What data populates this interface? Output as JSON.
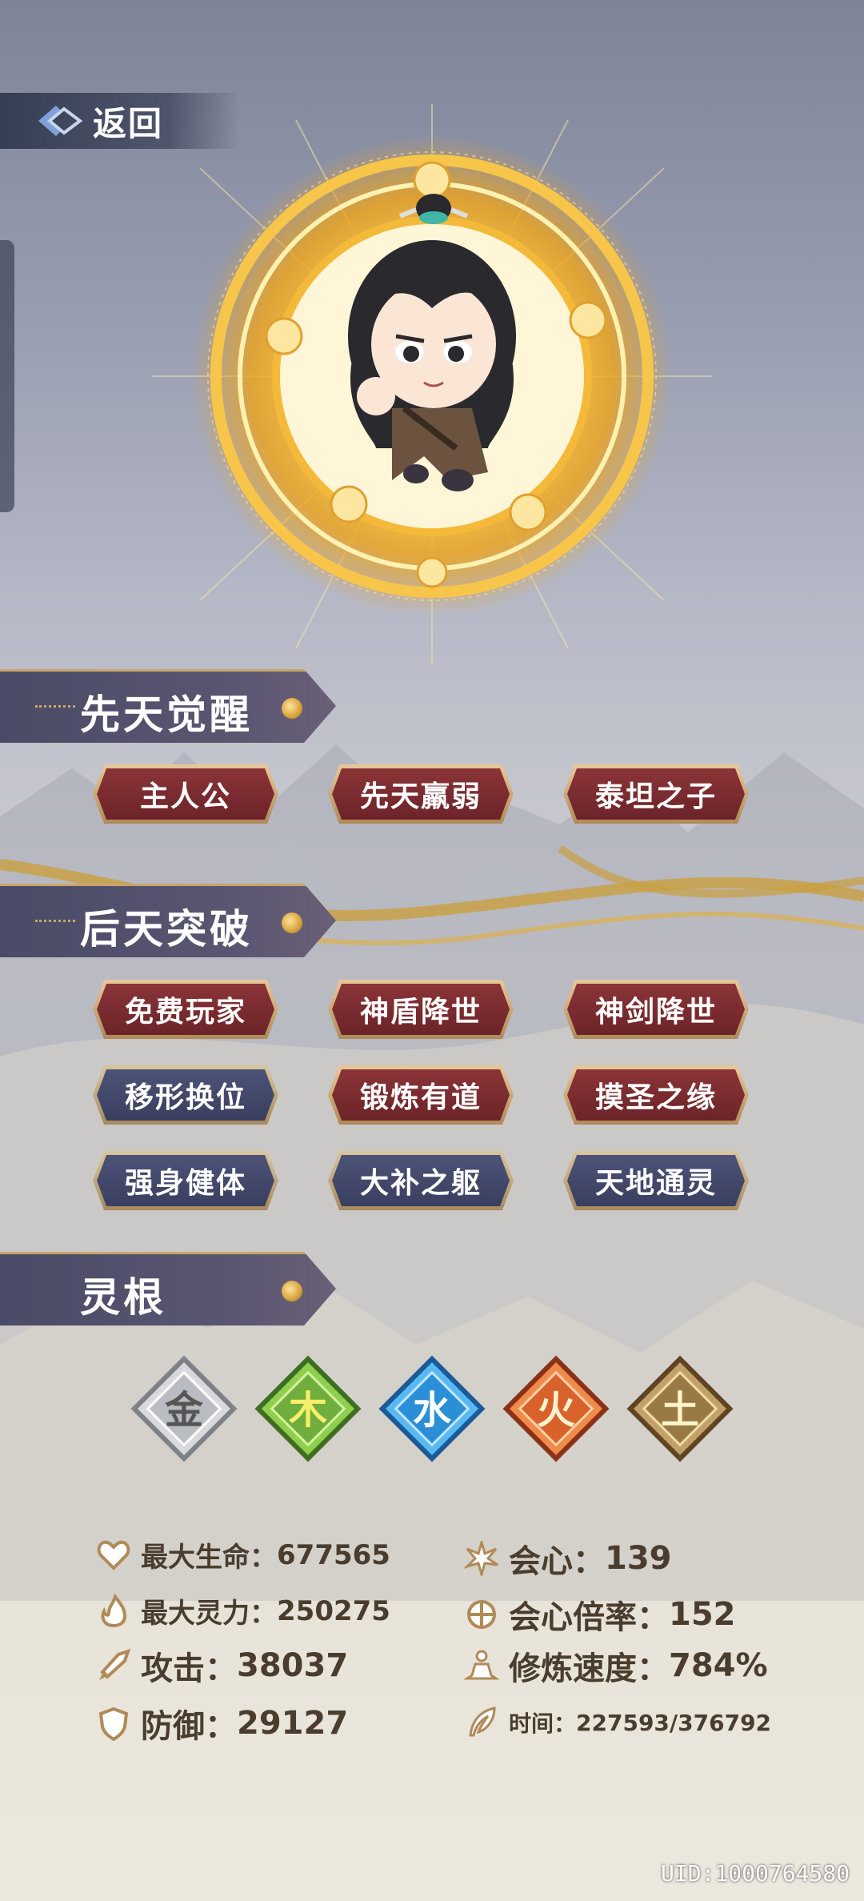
{
  "nav": {
    "back_label": "返回"
  },
  "sections": {
    "innate": {
      "title": "先天觉醒",
      "tags": [
        {
          "label": "主人公",
          "color": "red"
        },
        {
          "label": "先天羸弱",
          "color": "red"
        },
        {
          "label": "泰坦之子",
          "color": "red"
        }
      ]
    },
    "acquired": {
      "title": "后天突破",
      "tags": [
        {
          "label": "免费玩家",
          "color": "red"
        },
        {
          "label": "神盾降世",
          "color": "red"
        },
        {
          "label": "神剑降世",
          "color": "red"
        },
        {
          "label": "移形换位",
          "color": "blue"
        },
        {
          "label": "锻炼有道",
          "color": "red"
        },
        {
          "label": "摸圣之缘",
          "color": "red"
        },
        {
          "label": "强身健体",
          "color": "blue"
        },
        {
          "label": "大补之躯",
          "color": "blue"
        },
        {
          "label": "天地通灵",
          "color": "blue"
        }
      ]
    },
    "spirit_root": {
      "title": "灵根",
      "elements": [
        {
          "char": "金",
          "icon": "metal-element-icon",
          "color": "#b9bcc2"
        },
        {
          "char": "木",
          "icon": "wood-element-icon",
          "color": "#6fae3c"
        },
        {
          "char": "水",
          "icon": "water-element-icon",
          "color": "#2a8fd6"
        },
        {
          "char": "火",
          "icon": "fire-element-icon",
          "color": "#d8622a"
        },
        {
          "char": "土",
          "icon": "earth-element-icon",
          "color": "#9a7a44"
        }
      ]
    }
  },
  "stats": {
    "max_hp": {
      "label": "最大生命：",
      "value": "677565",
      "icon": "heart-icon"
    },
    "max_spirit": {
      "label": "最大灵力：",
      "value": "250275",
      "icon": "flame-icon"
    },
    "attack": {
      "label": "攻击：",
      "value": "38037",
      "icon": "sword-icon"
    },
    "defense": {
      "label": "防御：",
      "value": "29127",
      "icon": "shield-icon"
    },
    "crit": {
      "label": "会心：",
      "value": "139",
      "icon": "burst-icon"
    },
    "crit_mult": {
      "label": "会心倍率：",
      "value": "152",
      "icon": "target-icon"
    },
    "cultivation_speed": {
      "label": "修炼速度：",
      "value": "784%",
      "icon": "meditate-icon"
    },
    "time": {
      "label": "时间：",
      "value": "227593/376792",
      "icon": "feather-icon"
    }
  },
  "footer": {
    "uid": "UID:1000764580"
  },
  "colors": {
    "gold": "#c9a56a",
    "text_brown": "#4a3d2e",
    "tag_red": "#7a2c30",
    "tag_blue": "#434868"
  }
}
